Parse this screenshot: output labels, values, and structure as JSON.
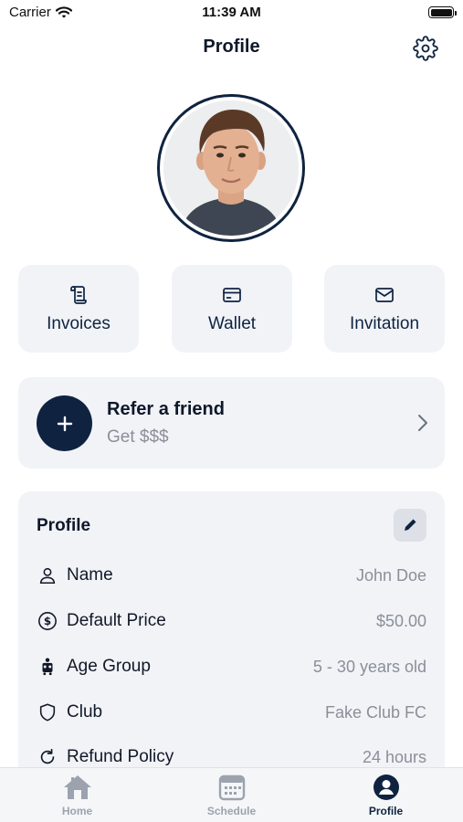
{
  "status_bar": {
    "carrier": "Carrier",
    "time": "11:39 AM"
  },
  "header": {
    "title": "Profile",
    "settings_icon": "gear-icon"
  },
  "avatar": {
    "icon": "user-photo"
  },
  "quick_actions": [
    {
      "label": "Invoices",
      "icon": "receipt-icon"
    },
    {
      "label": "Wallet",
      "icon": "credit-card-icon"
    },
    {
      "label": "Invitation",
      "icon": "envelope-icon"
    }
  ],
  "refer": {
    "title": "Refer a friend",
    "subtitle": "Get $$$",
    "icon": "plus-icon"
  },
  "profile_card": {
    "title": "Profile",
    "edit_icon": "pencil-icon",
    "rows": [
      {
        "label": "Name",
        "value": "John Doe",
        "icon": "person-icon"
      },
      {
        "label": "Default Price",
        "value": "$50.00",
        "icon": "dollar-circle-icon"
      },
      {
        "label": "Age Group",
        "value": "5 - 30 years old",
        "icon": "people-group-icon"
      },
      {
        "label": "Club",
        "value": "Fake Club FC",
        "icon": "shield-icon"
      },
      {
        "label": "Refund Policy",
        "value": "24 hours",
        "icon": "refresh-icon"
      }
    ]
  },
  "tabbar": {
    "tabs": [
      {
        "label": "Home",
        "icon": "home-icon",
        "active": false
      },
      {
        "label": "Schedule",
        "icon": "calendar-icon",
        "active": false
      },
      {
        "label": "Profile",
        "icon": "person-circle-icon",
        "active": true
      }
    ]
  },
  "colors": {
    "primary": "#0f2340",
    "card_bg": "#f1f3f7",
    "muted_text": "#8a8f98",
    "tab_inactive": "#9ca3af"
  }
}
